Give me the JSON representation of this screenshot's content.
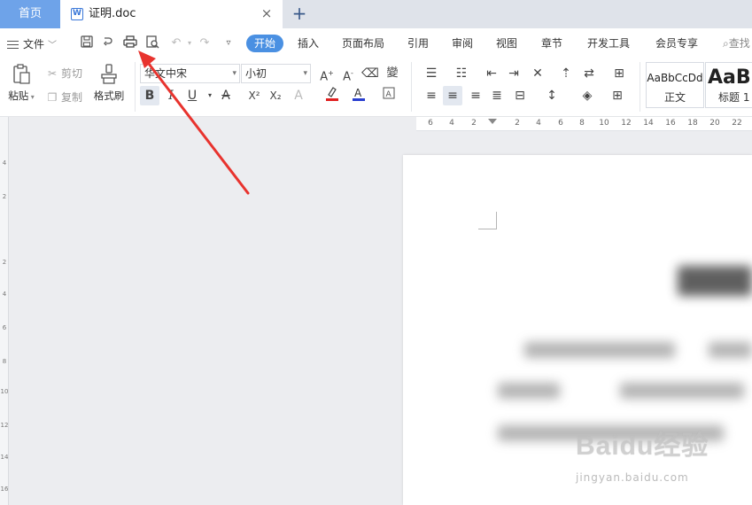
{
  "tabs": {
    "home": "首页",
    "document": "证明.doc",
    "close_glyph": "×",
    "add_glyph": "+"
  },
  "menu": {
    "file_label": "文件",
    "tabs": [
      "开始",
      "插入",
      "页面布局",
      "引用",
      "审阅",
      "视图",
      "章节",
      "开发工具",
      "会员专享"
    ],
    "active_tab": "开始",
    "search_label": "查找"
  },
  "ribbon": {
    "paste": "粘贴",
    "cut": "剪切",
    "copy": "复制",
    "format_painter": "格式刷",
    "font_name": "华文中宋",
    "font_size": "小初",
    "bold": "B",
    "italic": "I",
    "underline": "U",
    "styles": [
      {
        "preview": "AaBbCcDd",
        "name": "正文"
      },
      {
        "preview": "AaBb",
        "name": "标题 1"
      }
    ]
  },
  "ruler": {
    "ticks": [
      "6",
      "4",
      "2",
      "2",
      "4",
      "6",
      "8",
      "10",
      "12",
      "14",
      "16",
      "18",
      "20",
      "22"
    ],
    "vertical_ticks": [
      "4",
      "2",
      "2",
      "4",
      "6",
      "8",
      "10",
      "12",
      "14",
      "16"
    ]
  },
  "watermark": {
    "logo": "Baidu经验",
    "url": "jingyan.baidu.com"
  },
  "colors": {
    "accent": "#4a90e2",
    "home_tab": "#6ea3e9",
    "arrow": "#e8332e",
    "highlight_bar": "#e02020",
    "font_color_bar": "#2a3fd0"
  }
}
